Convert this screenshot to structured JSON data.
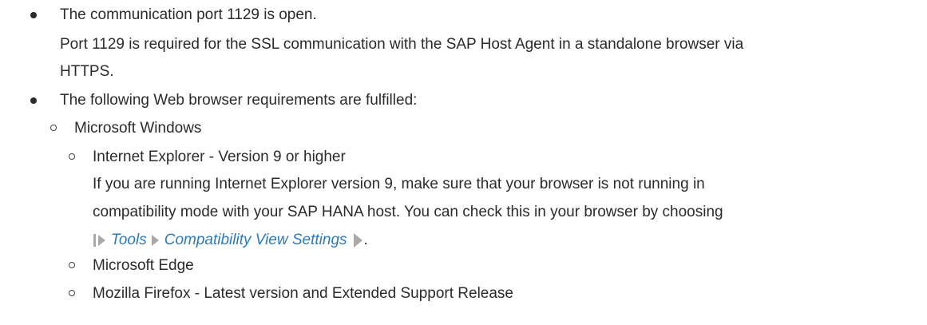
{
  "items": {
    "port_open": "The communication port 1129 is open.",
    "port_desc_line1": "Port 1129 is required for the SSL communication with the SAP Host Agent in a standalone browser via",
    "port_desc_line2": "HTTPS.",
    "browser_req": "The following Web browser requirements are fulfilled:",
    "windows": "Microsoft Windows",
    "ie": "Internet Explorer - Version 9 or higher",
    "ie_note_line1": "If you are running Internet Explorer version 9, make sure that your browser is not running in",
    "ie_note_line2": "compatibility mode with your SAP HANA host. You can check this in your browser by choosing",
    "edge": "Microsoft Edge",
    "firefox": "Mozilla Firefox - Latest version and Extended Support Release"
  },
  "menu_path": {
    "step1": "Tools",
    "step2": "Compatibility View Settings",
    "trailing": "."
  },
  "colors": {
    "text": "#2b2b2b",
    "link": "#2a7ac0",
    "arrow": "#a9a9a9"
  }
}
